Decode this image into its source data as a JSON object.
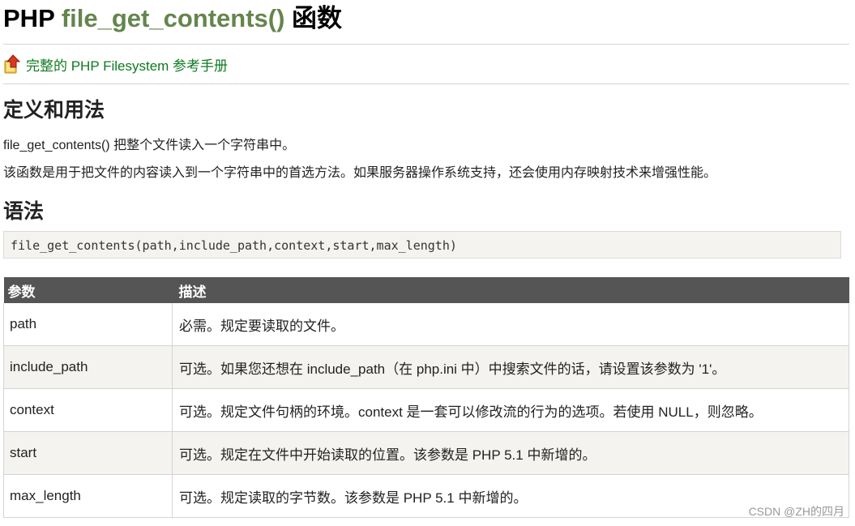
{
  "page": {
    "title_prefix": "PHP",
    "title_function": "file_get_contents()",
    "title_suffix": "函数"
  },
  "reference_link": {
    "label": "完整的 PHP Filesystem 参考手册",
    "icon": "arrow-up-book-icon"
  },
  "definition": {
    "heading": "定义和用法",
    "paragraphs": [
      "file_get_contents() 把整个文件读入一个字符串中。",
      "该函数是用于把文件的内容读入到一个字符串中的首选方法。如果服务器操作系统支持，还会使用内存映射技术来增强性能。"
    ]
  },
  "syntax": {
    "heading": "语法",
    "code": "file_get_contents(path,include_path,context,start,max_length)"
  },
  "params_table": {
    "headers": [
      "参数",
      "描述"
    ],
    "rows": [
      {
        "param": "path",
        "desc": "必需。规定要读取的文件。"
      },
      {
        "param": "include_path",
        "desc": "可选。如果您还想在 include_path（在 php.ini 中）中搜索文件的话，请设置该参数为 '1'。"
      },
      {
        "param": "context",
        "desc": "可选。规定文件句柄的环境。context 是一套可以修改流的行为的选项。若使用 NULL，则忽略。"
      },
      {
        "param": "start",
        "desc": "可选。规定在文件中开始读取的位置。该参数是 PHP 5.1 中新增的。"
      },
      {
        "param": "max_length",
        "desc": "可选。规定读取的字节数。该参数是 PHP 5.1 中新增的。"
      }
    ]
  },
  "watermark": "CSDN @ZH的四月",
  "colors": {
    "function_name": "#64854c",
    "link": "#0f7a1f",
    "table_header_bg": "#555555",
    "alt_row_bg": "#f4f3ef"
  }
}
